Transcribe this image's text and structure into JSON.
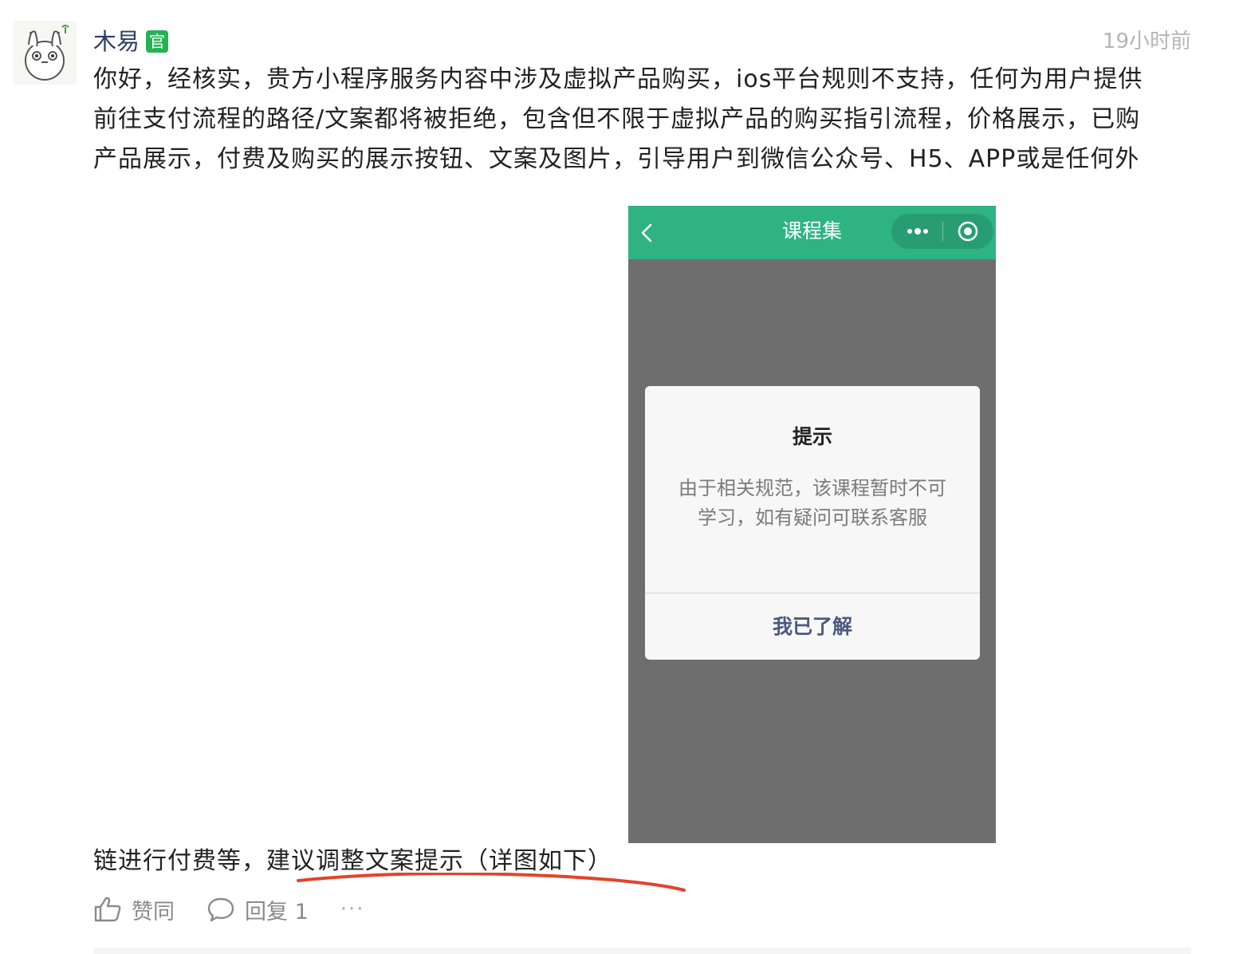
{
  "comment": {
    "username": "木易",
    "badge": "官",
    "time": "19小时前",
    "text_lines": [
      "你好，经核实，贵方小程序服务内容中涉及虚拟产品购买，ios平台规则不支持，任何为用户提供",
      "前往支付流程的路径/文案都将被拒绝，包含但不限于虚拟产品的购买指引流程，价格展示，已购",
      "产品展示，付费及购买的展示按钮、文案及图片，引导用户到微信公众号、H5、APP或是任何外"
    ],
    "text_last_line": "链进行付费等，建议调整文案提示（详图如下）"
  },
  "phone": {
    "nav_title": "课程集",
    "dialog": {
      "title": "提示",
      "message": "由于相关规范，该课程暂时不可学习，如有疑问可联系客服",
      "button": "我已了解"
    }
  },
  "actions": {
    "like_label": "赞同",
    "reply_label": "回复 1",
    "more_label": "···"
  },
  "colors": {
    "nav_green": "#2fb383",
    "badge_green": "#27b155",
    "underline_red": "#e0452a"
  }
}
